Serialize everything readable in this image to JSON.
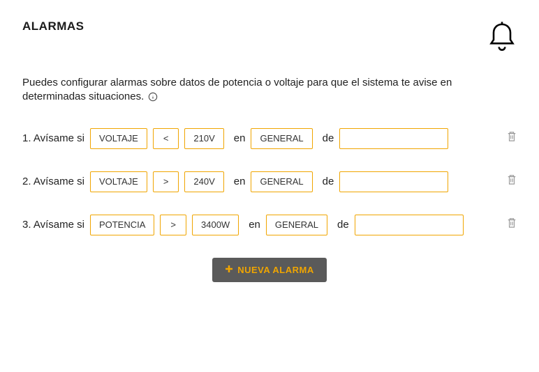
{
  "title": "ALARMAS",
  "description": "Puedes configurar alarmas sobre datos de potencia o voltaje para que el sistema te avise en determinadas situaciones.",
  "row_prefix": "Avísame si",
  "connector_en": "en",
  "connector_de": "de",
  "alarms": [
    {
      "index": "1.",
      "metric": "VOLTAJE",
      "op": "<",
      "threshold": "210V",
      "scope": "GENERAL",
      "extra": ""
    },
    {
      "index": "2.",
      "metric": "VOLTAJE",
      "op": ">",
      "threshold": "240V",
      "scope": "GENERAL",
      "extra": ""
    },
    {
      "index": "3.",
      "metric": "POTENCIA",
      "op": ">",
      "threshold": "3400W",
      "scope": "GENERAL",
      "extra": ""
    }
  ],
  "button_label": "NUEVA ALARMA"
}
